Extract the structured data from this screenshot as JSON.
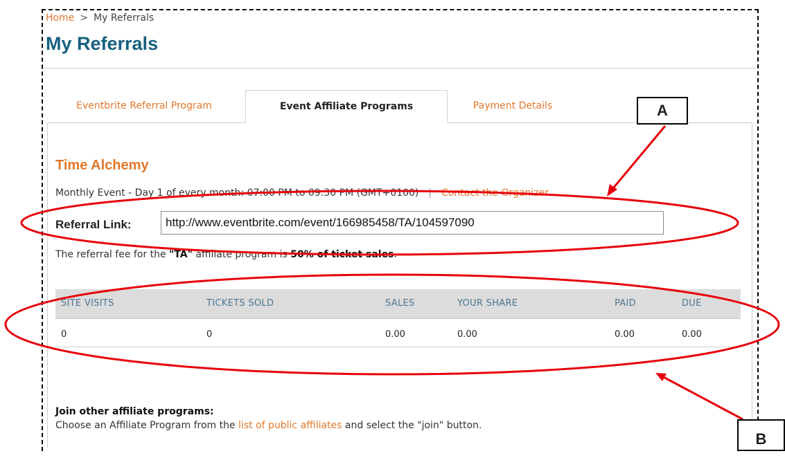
{
  "breadcrumb": {
    "home": "Home",
    "separator": ">",
    "current": "My Referrals"
  },
  "page_title": "My Referrals",
  "tabs": [
    {
      "label": "Eventbrite Referral Program",
      "active": false
    },
    {
      "label": "Event Affiliate Programs",
      "active": true
    },
    {
      "label": "Payment Details",
      "active": false
    }
  ],
  "event": {
    "title": "Time Alchemy",
    "schedule": "Monthly Event - Day 1 of every month: 07:00 PM to 09:30 PM (GMT+0100)",
    "separator": "|",
    "contact_link": "Contact the Organizer"
  },
  "referral": {
    "label": "Referral Link:",
    "value": "http://www.eventbrite.com/event/166985458/TA/104597090"
  },
  "fee": {
    "prefix": "The referral fee for the ",
    "program": "\"TA\"",
    "middle": " affiliate program is ",
    "amount": "50% of ticket sales",
    "suffix": "."
  },
  "stats": {
    "headers": [
      "SITE VISITS",
      "TICKETS SOLD",
      "SALES",
      "YOUR SHARE",
      "PAID",
      "DUE"
    ],
    "row": [
      "0",
      "0",
      "0.00",
      "0.00",
      "0.00",
      "0.00"
    ]
  },
  "join": {
    "title": "Join other affiliate programs:",
    "text_before": "Choose an Affiliate Program from the ",
    "link": "list of public affiliates",
    "text_after": " and select the \"join\" button."
  },
  "annotations": {
    "a": "A",
    "b": "B",
    "color": "#e8000b"
  }
}
